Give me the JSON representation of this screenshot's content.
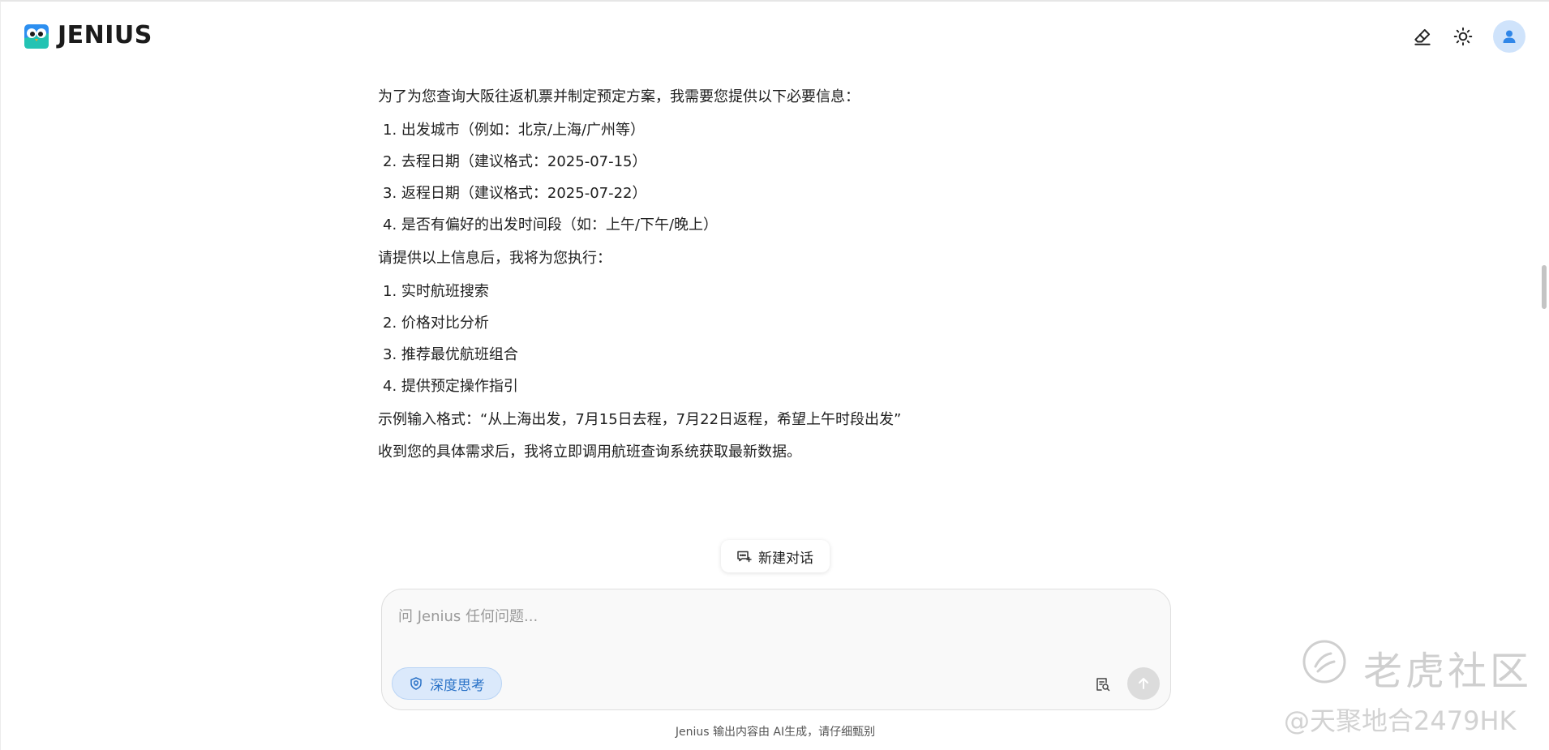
{
  "app": {
    "name": "JENIUS"
  },
  "header": {
    "clear_icon": "eraser-icon",
    "theme_icon": "sun-icon",
    "avatar_icon": "user-icon"
  },
  "message": {
    "intro": "为了为您查询大阪往返机票并制定预定方案，我需要您提供以下必要信息：",
    "required_items": [
      "1. 出发城市（例如：北京/上海/广州等）",
      "2. 去程日期（建议格式：2025-07-15）",
      "3. 返程日期（建议格式：2025-07-22）",
      "4. 是否有偏好的出发时间段（如：上午/下午/晚上）"
    ],
    "followup": "请提供以上信息后，我将为您执行：",
    "actions": [
      "1. 实时航班搜索",
      "2. 价格对比分析",
      "3. 推荐最优航班组合",
      "4. 提供预定操作指引"
    ],
    "example": "示例输入格式：“从上海出发，7月15日去程，7月22日返程，希望上午时段出发”",
    "closing": "收到您的具体需求后，我将立即调用航班查询系统获取最新数据。"
  },
  "new_chat": {
    "label": "新建对话",
    "icon": "chat-plus-icon"
  },
  "input": {
    "placeholder": "问 Jenius 任何问题...",
    "value": "",
    "deep_think_label": "深度思考",
    "deep_think_icon": "bulb-icon",
    "attach_icon": "file-search-icon",
    "send_icon": "arrow-up-icon"
  },
  "disclaimer": "Jenius 输出内容由 AI生成，请仔细甄别",
  "watermark": {
    "brand": "老虎社区",
    "handle": "@天聚地合2479HK"
  },
  "colors": {
    "accent": "#2a72c7",
    "accent_bg": "#dbe9fb",
    "avatar_bg": "#cfe3fb"
  }
}
